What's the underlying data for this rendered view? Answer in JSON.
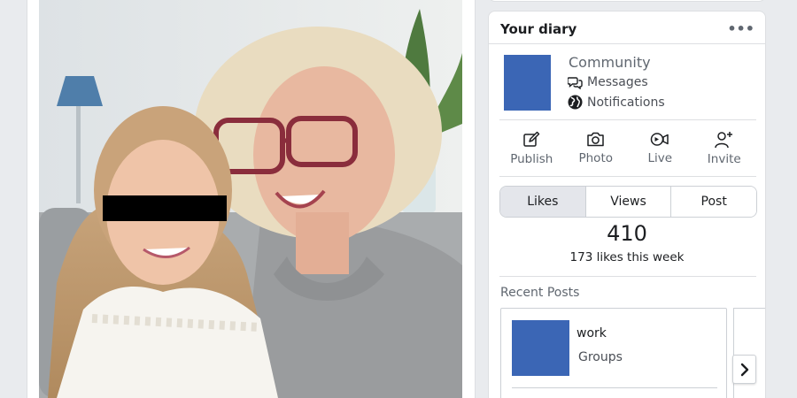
{
  "diary": {
    "title": "Your diary",
    "more_icon": "more-horizontal-icon",
    "community_name": "Community",
    "messages_label": "Messages",
    "notifications_label": "Notifications",
    "actions": [
      {
        "label": "Publish",
        "icon": "edit-icon"
      },
      {
        "label": "Photo",
        "icon": "camera-icon"
      },
      {
        "label": "Live",
        "icon": "live-video-icon"
      },
      {
        "label": "Invite",
        "icon": "add-person-icon"
      }
    ],
    "tabs": [
      {
        "label": "Likes",
        "active": true
      },
      {
        "label": "Views",
        "active": false
      },
      {
        "label": "Post",
        "active": false
      }
    ],
    "stat_value": "410",
    "stat_caption": "173 likes this week",
    "recent_posts_title": "Recent Posts",
    "recent_post": {
      "title": "work",
      "subtitle": "Groups"
    },
    "next_icon": "chevron-right-icon"
  },
  "colors": {
    "accent_thumb": "#3b66b5",
    "page_bg": "#e9ebee",
    "active_tab_bg": "#e4e6eb"
  }
}
